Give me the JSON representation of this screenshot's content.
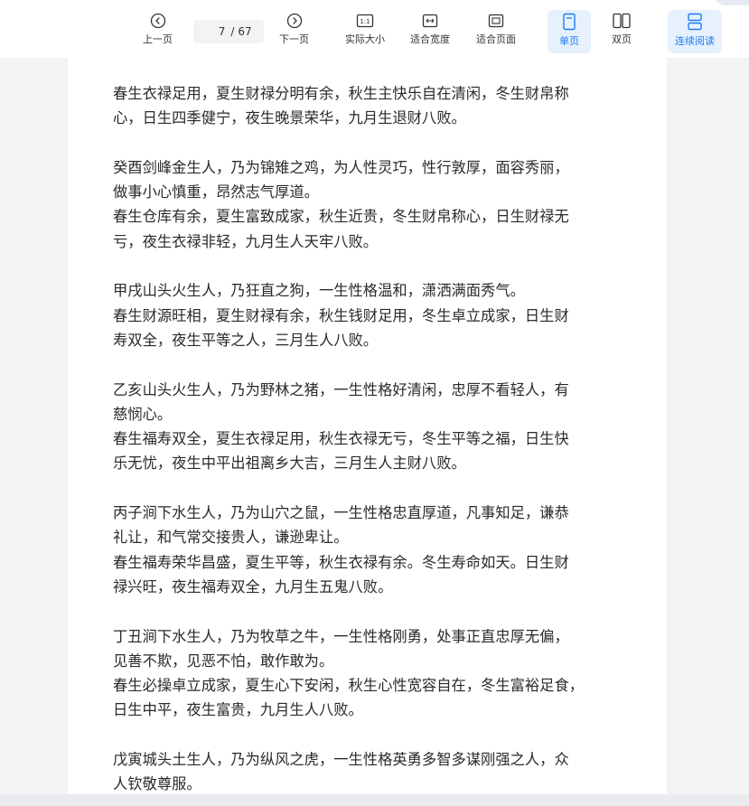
{
  "toolbar": {
    "prev_label": "上一页",
    "current_page": "7",
    "page_separator": "/",
    "total_pages": "67",
    "next_label": "下一页",
    "actual_size_label": "实际大小",
    "actual_size_icon_text": "1:1",
    "fit_width_label": "适合宽度",
    "fit_page_label": "适合页面",
    "single_page_label": "单页",
    "double_page_label": "双页",
    "continuous_label": "连续阅读",
    "accent_color": "#1d7bf2"
  },
  "document": {
    "paragraphs": [
      {
        "lines": [
          "春生衣禄足用，夏生财禄分明有余，秋生主快乐自在清闲，冬生财帛称",
          "心，日生四季健宁，夜生晚景荣华，九月生退财八败。"
        ]
      },
      {
        "lines": [
          "癸酉剑峰金生人，乃为锦雉之鸡，为人性灵巧，性行敦厚，面容秀丽，",
          "做事小心慎重，昂然志气厚道。",
          "春生仓库有余，夏生富致成家，秋生近贵，冬生财帛称心，日生财禄无",
          "亏，夜生衣禄非轻，九月生人天牢八败。"
        ]
      },
      {
        "lines": [
          "甲戌山头火生人，乃狂直之狗，一生性格温和，潇洒满面秀气。",
          "春生财源旺相，夏生财禄有余，秋生钱财足用，冬生卓立成家，日生财",
          "寿双全，夜生平等之人，三月生人八败。"
        ]
      },
      {
        "lines": [
          "乙亥山头火生人，乃为野林之猪，一生性格好清闲，忠厚不看轻人，有",
          "慈悯心。",
          "春生福寿双全，夏生衣禄足用，秋生衣禄无亏，冬生平等之福，日生快",
          "乐无忧，夜生中平出祖离乡大吉，三月生人主财八败。"
        ]
      },
      {
        "lines": [
          "丙子涧下水生人，乃为山穴之鼠，一生性格忠直厚道，凡事知足，谦恭",
          "礼让，和气常交接贵人，谦逊卑让。",
          "春生福寿荣华昌盛，夏生平等，秋生衣禄有余。冬生寿命如天。日生财",
          "禄兴旺，夜生福寿双全，九月生五鬼八败。"
        ]
      },
      {
        "lines": [
          "丁丑涧下水生人，乃为牧草之牛，一生性格刚勇，处事正直忠厚无偏，",
          "见善不欺，见恶不怕，敢作敢为。",
          "春生必操卓立成家，夏生心下安闲，秋生心性宽容自在，冬生富裕足食，",
          "日生中平，夜生富贵，九月生人八败。"
        ]
      },
      {
        "lines": [
          "戊寅城头土生人，乃为纵风之虎，一生性格英勇多智多谋刚强之人，众",
          "人钦敬尊服。"
        ]
      }
    ]
  }
}
